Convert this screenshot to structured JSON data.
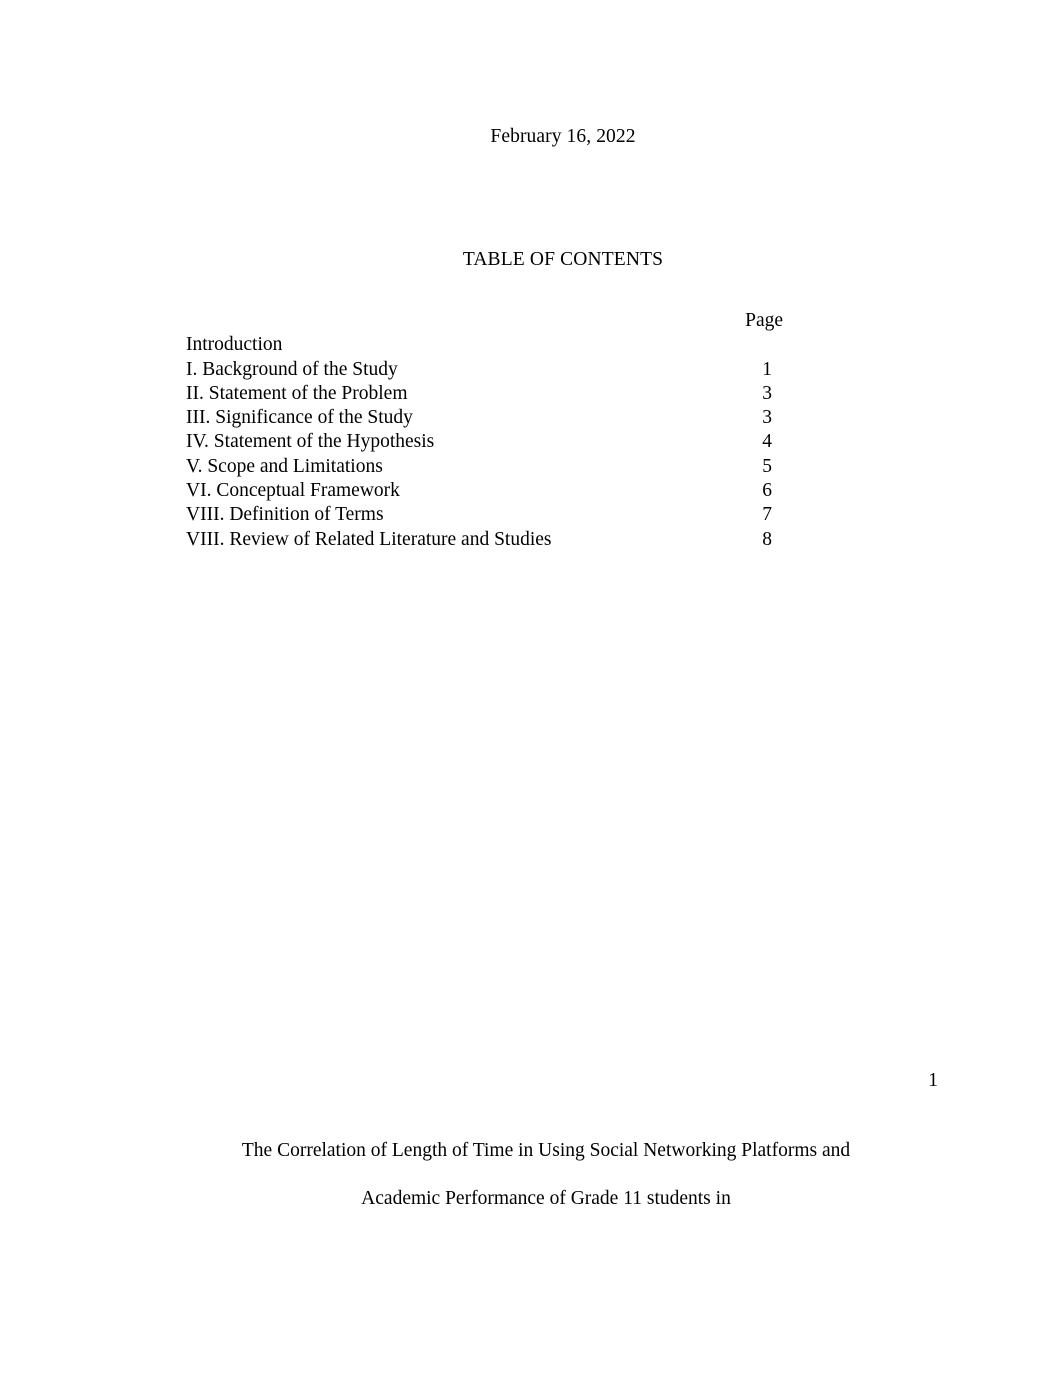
{
  "document": {
    "date": "February 16, 2022",
    "toc_heading": "TABLE OF CONTENTS",
    "page_column_header": "Page",
    "folio": "1"
  },
  "toc": {
    "entries": [
      {
        "label": "Introduction",
        "page": ""
      },
      {
        "label": "I. Background of the Study",
        "page": "1"
      },
      {
        "label": "II. Statement of the Problem",
        "page": "3"
      },
      {
        "label": "III. Significance of the Study",
        "page": "3"
      },
      {
        "label": "IV. Statement of the Hypothesis",
        "page": "4"
      },
      {
        "label": "V. Scope and Limitations",
        "page": "5"
      },
      {
        "label": "VI. Conceptual Framework",
        "page": "6"
      },
      {
        "label": "VIII. Definition of Terms",
        "page": "7"
      },
      {
        "label": "VIII. Review of Related Literature and Studies",
        "page": "8"
      }
    ]
  },
  "title": {
    "lines": [
      "The Correlation of Length of Time in Using Social Networking Platforms and",
      "Academic Performance of Grade 11 students in"
    ]
  },
  "colors": {
    "text": "#000000",
    "background": "#ffffff"
  }
}
